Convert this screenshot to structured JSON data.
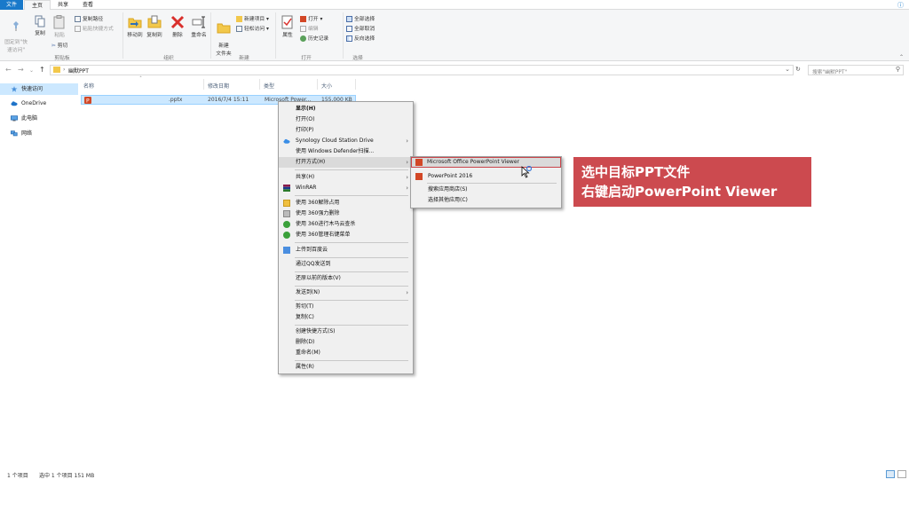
{
  "ribbon_tabs": [
    "文件",
    "主页",
    "共享",
    "查看"
  ],
  "ribbon": {
    "pin_label": "固定到\"快\n速访问\"",
    "copy_label": "复制",
    "paste_label": "粘贴",
    "copy_path": "复制路径",
    "paste_shortcut": "粘贴快捷方式",
    "cut": "剪切",
    "group_clipboard": "剪贴板",
    "move_to": "移动到",
    "copy_to": "复制到",
    "delete": "删除",
    "rename": "重命名",
    "group_organize": "组织",
    "new_folder": "新建\n文件夹",
    "new_item": "新建项目",
    "easy_access": "轻松访问",
    "group_new": "新建",
    "properties": "属性",
    "open": "打开",
    "edit": "编辑",
    "history": "历史记录",
    "group_open": "打开",
    "select_all": "全部选择",
    "select_none": "全部取消",
    "invert_selection": "反向选择",
    "group_select": "选择"
  },
  "address": {
    "path": "幽默PPT",
    "search_placeholder": "搜索\"幽默PPT\""
  },
  "navpane": [
    "快速访问",
    "OneDrive",
    "此电脑",
    "网络"
  ],
  "columns": [
    "名称",
    "修改日期",
    "类型",
    "大小"
  ],
  "file": {
    "name": ".pptx",
    "date": "2016/7/4 15:11",
    "type": "Microsoft Power...",
    "size": "155,000 KB"
  },
  "context_menu": [
    "显示(H)",
    "打开(O)",
    "打印(P)",
    "Synology Cloud Station Drive",
    "使用 Windows Defender扫描...",
    "打开方式(H)",
    "共享(H)",
    "WinRAR",
    "使用 360解除占用",
    "使用 360强力删除",
    "使用 360进行木马云查杀",
    "使用 360管理右键菜单",
    "上传到百度云",
    "通过QQ发送到",
    "还原以前的版本(V)",
    "发送到(N)",
    "剪切(T)",
    "复制(C)",
    "创建快捷方式(S)",
    "删除(D)",
    "重命名(M)",
    "属性(R)"
  ],
  "submenu": [
    "Microsoft Office PowerPoint Viewer",
    "PowerPoint 2016",
    "搜索应用商店(S)",
    "选择其他应用(C)"
  ],
  "annotation": {
    "line1": "选中目标PPT文件",
    "line2": "右键启动PowerPoint  Viewer"
  },
  "status": {
    "count": "1 个项目",
    "selected": "选中 1 个项目  151 MB"
  },
  "colors": {
    "accent": "#1979ca",
    "selection": "#cce8ff",
    "annotation": "#cc4a4f"
  }
}
